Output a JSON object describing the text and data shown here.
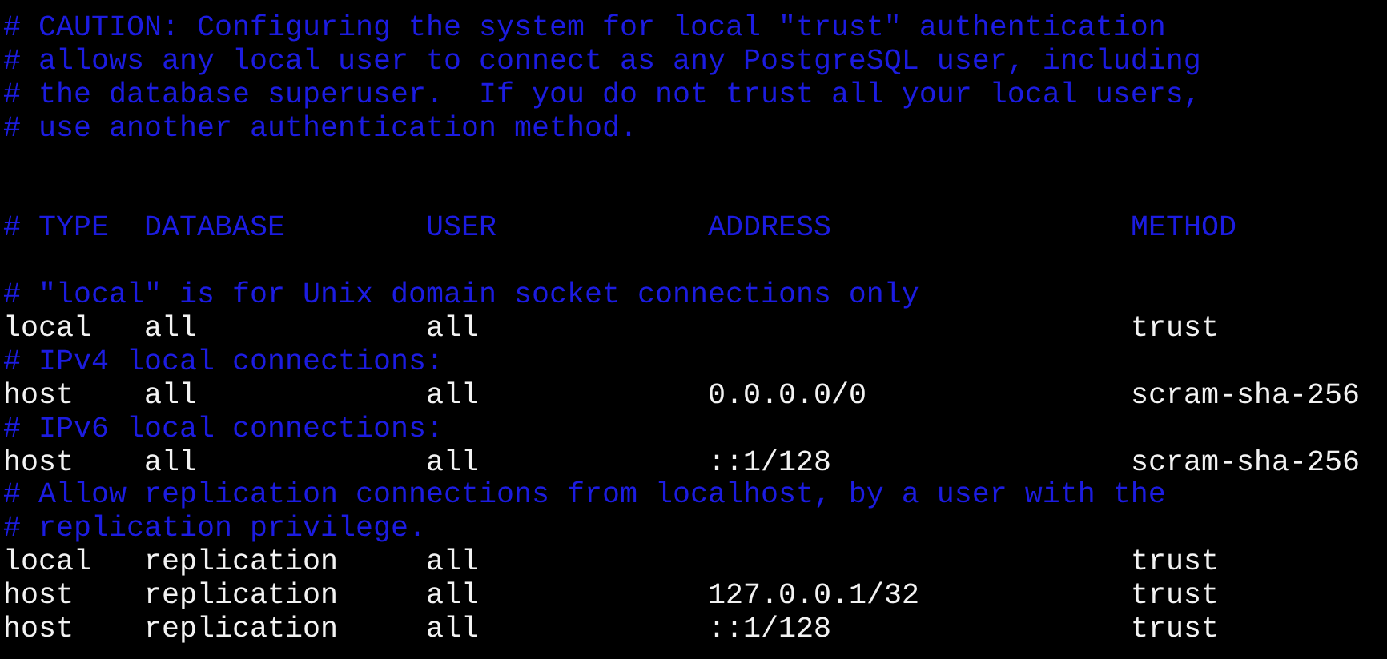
{
  "lines": [
    {
      "kind": "comment",
      "text": "# CAUTION: Configuring the system for local \"trust\" authentication"
    },
    {
      "kind": "comment",
      "text": "# allows any local user to connect as any PostgreSQL user, including"
    },
    {
      "kind": "comment",
      "text": "# the database superuser.  If you do not trust all your local users,"
    },
    {
      "kind": "comment",
      "text": "# use another authentication method."
    },
    {
      "kind": "blank"
    },
    {
      "kind": "blank"
    },
    {
      "kind": "header",
      "columns": [
        "# TYPE",
        "DATABASE",
        "USER",
        "ADDRESS",
        "METHOD"
      ]
    },
    {
      "kind": "blank"
    },
    {
      "kind": "comment",
      "text": "# \"local\" is for Unix domain socket connections only"
    },
    {
      "kind": "entry",
      "type": "local",
      "database": "all",
      "user": "all",
      "method": "trust"
    },
    {
      "kind": "comment",
      "text": "# IPv4 local connections:"
    },
    {
      "kind": "entry",
      "type": "host",
      "database": "all",
      "user": "all",
      "address": "0.0.0.0/0",
      "method": "scram-sha-256"
    },
    {
      "kind": "comment",
      "text": "# IPv6 local connections:"
    },
    {
      "kind": "entry",
      "type": "host",
      "database": "all",
      "user": "all",
      "address": "::1/128",
      "method": "scram-sha-256"
    },
    {
      "kind": "comment",
      "text": "# Allow replication connections from localhost, by a user with the"
    },
    {
      "kind": "comment",
      "text": "# replication privilege."
    },
    {
      "kind": "entry",
      "type": "local",
      "database": "replication",
      "user": "all",
      "method": "trust"
    },
    {
      "kind": "entry",
      "type": "host",
      "database": "replication",
      "user": "all",
      "address": "127.0.0.1/32",
      "method": "trust"
    },
    {
      "kind": "entry",
      "type": "host",
      "database": "replication",
      "user": "all",
      "address": "::1/128",
      "method": "trust"
    }
  ]
}
